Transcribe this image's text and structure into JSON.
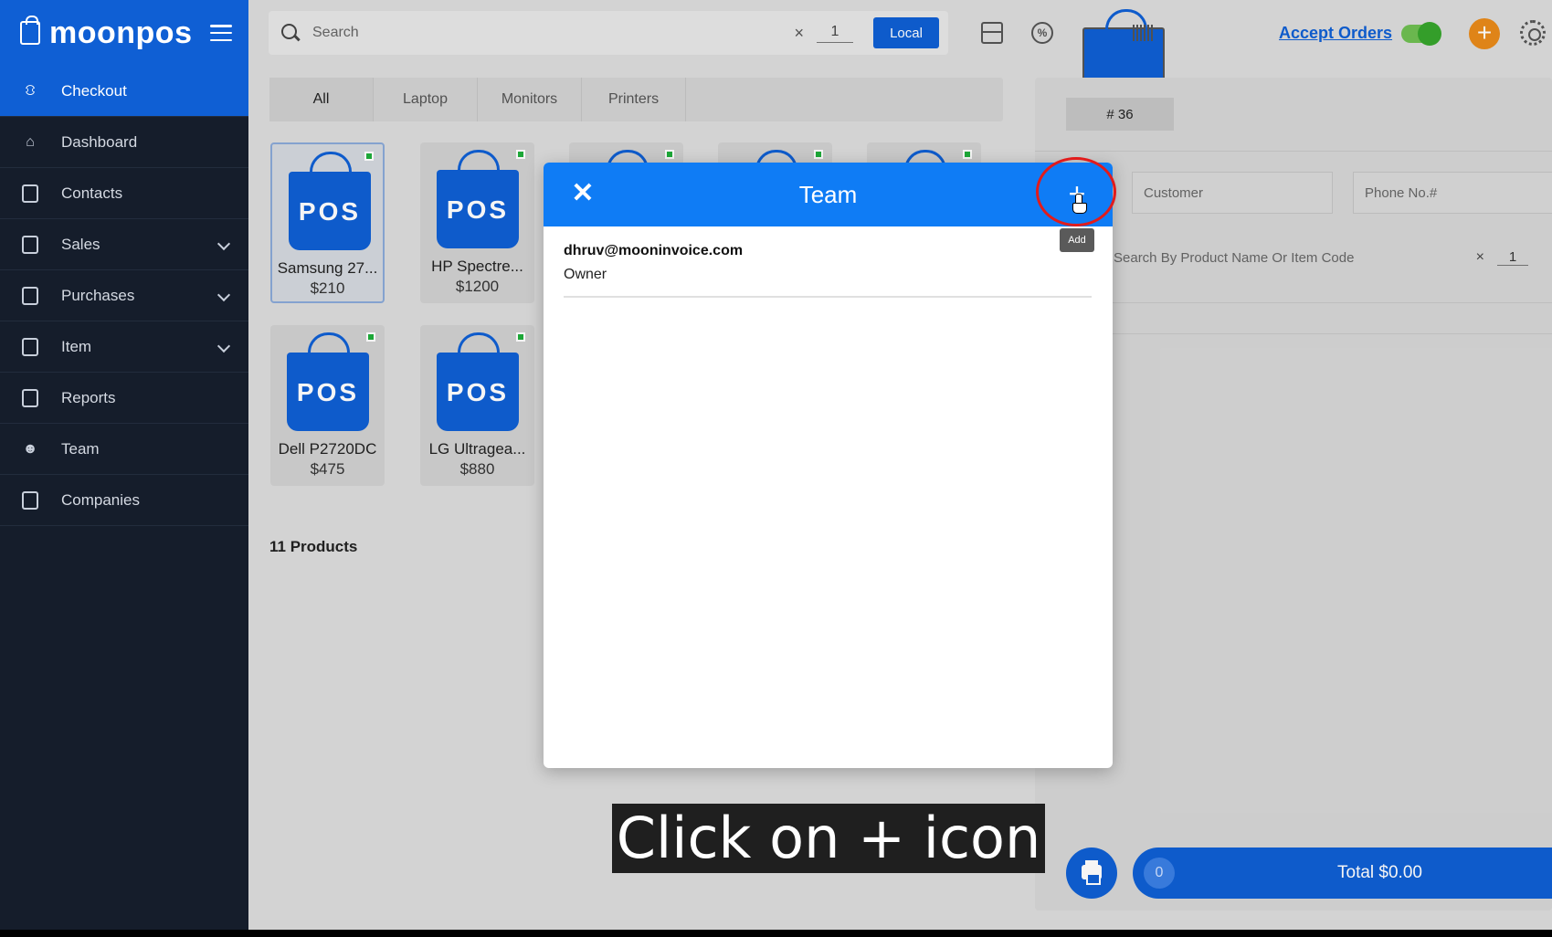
{
  "brand": {
    "name": "moonpos"
  },
  "sidebar": {
    "items": [
      {
        "label": "Checkout",
        "icon": "basket-icon",
        "active": true
      },
      {
        "label": "Dashboard",
        "icon": "home-icon"
      },
      {
        "label": "Contacts",
        "icon": "contacts-icon"
      },
      {
        "label": "Sales",
        "icon": "sales-icon"
      },
      {
        "label": "Purchases",
        "icon": "purchases-icon"
      },
      {
        "label": "Item",
        "icon": "item-icon"
      },
      {
        "label": "Reports",
        "icon": "reports-icon"
      },
      {
        "label": "Team",
        "icon": "team-icon"
      },
      {
        "label": "Companies",
        "icon": "companies-icon"
      }
    ]
  },
  "topbar": {
    "search_placeholder": "Search",
    "clear": "×",
    "qty": "1",
    "local_label": "Local",
    "accept_orders_label": "Accept Orders",
    "accept_orders_on": true,
    "add_symbol": "+"
  },
  "categories": [
    "All",
    "Laptop",
    "Monitors",
    "Printers"
  ],
  "products": [
    {
      "name": "Samsung 27...",
      "price": "$210",
      "badge": "POS"
    },
    {
      "name": "HP Spectre...",
      "price": "$1200",
      "badge": "POS"
    },
    {
      "name": "Dell P2720DC",
      "price": "$475",
      "badge": "POS"
    },
    {
      "name": "LG Ultragea...",
      "price": "$880",
      "badge": "POS"
    }
  ],
  "product_count": "11 Products",
  "order": {
    "number": "# 36",
    "customer_placeholder": "Customer",
    "phone_placeholder": "Phone No.#",
    "search_placeholder": "Search By Product Name Or Item Code",
    "clear": "×",
    "qty": "1",
    "item_count": "0",
    "total_label": "Total $0.00"
  },
  "modal": {
    "title": "Team",
    "close_symbol": "✕",
    "add_symbol": "+",
    "add_tooltip": "Add",
    "members": [
      {
        "email": "dhruv@mooninvoice.com",
        "role": "Owner"
      }
    ]
  },
  "caption": "Click on + icon",
  "colors": {
    "primary": "#0f5fd4",
    "header": "#0f7cf5",
    "sidebar": "#151d2b",
    "accent": "#e98a1a",
    "highlight": "#e21b1b"
  }
}
